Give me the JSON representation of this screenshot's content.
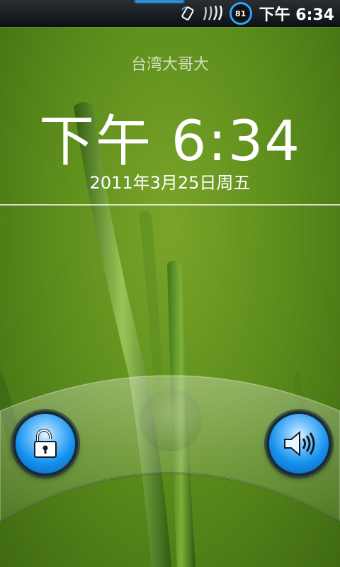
{
  "status_bar": {
    "battery_level": "81",
    "time": "下午 6:34",
    "accent_color": "#2fa4ff"
  },
  "lockscreen": {
    "carrier": "台湾大哥大",
    "clock": "下午 6:34",
    "date": "2011年3月25日周五"
  },
  "controls": {
    "left_icon": "unlock-icon",
    "right_icon": "speaker-icon",
    "button_color": "#1593ef"
  }
}
